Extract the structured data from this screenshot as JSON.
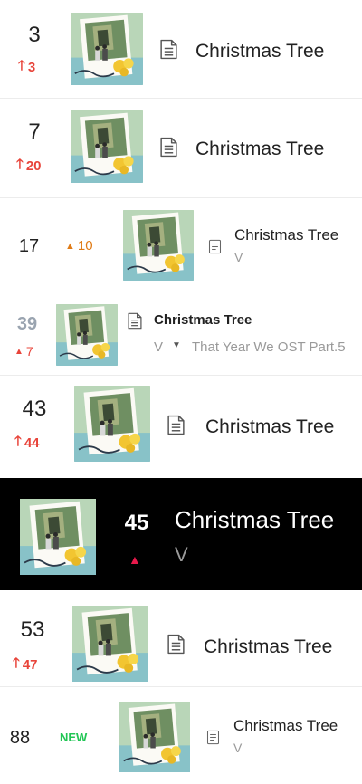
{
  "entries": [
    {
      "rank": "3",
      "change": "3",
      "title": "Christmas Tree"
    },
    {
      "rank": "7",
      "change": "20",
      "title": "Christmas Tree"
    },
    {
      "rank": "17",
      "change": "10",
      "title": "Christmas Tree",
      "artist": "V"
    },
    {
      "rank": "39",
      "change": "7",
      "title": "Christmas Tree",
      "artist": "V",
      "album": "That Year We OST Part.5"
    },
    {
      "rank": "43",
      "change": "44",
      "title": "Christmas Tree"
    },
    {
      "rank": "45",
      "title": "Christmas Tree",
      "artist": "V"
    },
    {
      "rank": "53",
      "change": "47",
      "title": "Christmas Tree"
    },
    {
      "rank": "88",
      "change": "NEW",
      "title": "Christmas Tree",
      "artist": "V"
    }
  ],
  "colors": {
    "up": "#e8443a",
    "up_alt": "#e07b16",
    "new": "#20c654",
    "dark_band": "#000000"
  }
}
